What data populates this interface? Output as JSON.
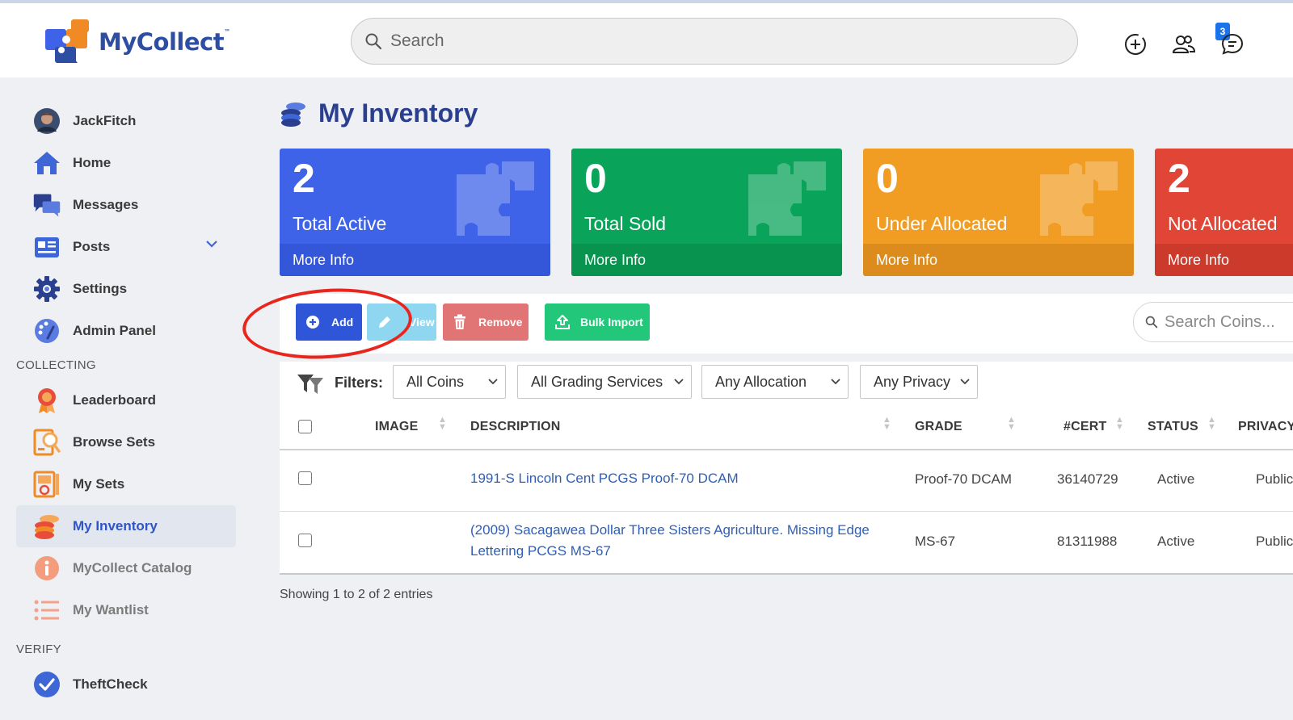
{
  "app": {
    "name": "MyCollect",
    "trademark": "™"
  },
  "header": {
    "search_placeholder": "Search",
    "notifications_badge": "3",
    "icons": [
      "add-circle-icon",
      "users-icon",
      "chat-icon"
    ]
  },
  "sidebar": {
    "user": "JackFitch",
    "items": [
      {
        "label": "Home",
        "icon": "home-icon"
      },
      {
        "label": "Messages",
        "icon": "messages-icon"
      },
      {
        "label": "Posts",
        "icon": "posts-icon"
      },
      {
        "label": "Settings",
        "icon": "gear-icon"
      },
      {
        "label": "Admin Panel",
        "icon": "palette-icon"
      }
    ],
    "collecting_header": "COLLECTING",
    "collecting": [
      {
        "label": "Leaderboard",
        "icon": "medal-icon"
      },
      {
        "label": "Browse Sets",
        "icon": "browse-sets-icon"
      },
      {
        "label": "My Sets",
        "icon": "my-sets-icon"
      },
      {
        "label": "My Inventory",
        "icon": "coins-stack-icon",
        "active": true
      },
      {
        "label": "MyCollect Catalog",
        "icon": "info-icon"
      },
      {
        "label": "My Wantlist",
        "icon": "list-icon"
      }
    ],
    "verify_header": "VERIFY",
    "verify": [
      {
        "label": "TheftCheck",
        "icon": "check-badge-icon"
      }
    ]
  },
  "page": {
    "title": "My Inventory"
  },
  "cards": [
    {
      "value": "2",
      "label": "Total Active",
      "more": "More Info",
      "color": "#3f63e8"
    },
    {
      "value": "0",
      "label": "Total Sold",
      "more": "More Info",
      "color": "#0aa35a"
    },
    {
      "value": "0",
      "label": "Under Allocated",
      "more": "More Info",
      "color": "#f19d24"
    },
    {
      "value": "2",
      "label": "Not Allocated",
      "more": "More Info",
      "color": "#e14536"
    }
  ],
  "toolbar": {
    "add": "Add",
    "view": "View",
    "remove": "Remove",
    "bulk_import": "Bulk Import",
    "search_placeholder": "Search Coins..."
  },
  "filters": {
    "label": "Filters:",
    "coins": "All Coins",
    "grading": "All Grading Services",
    "allocation": "Any Allocation",
    "privacy": "Any Privacy"
  },
  "table": {
    "columns": [
      "IMAGE",
      "DESCRIPTION",
      "GRADE",
      "#CERT",
      "STATUS",
      "PRIVACY"
    ],
    "rows": [
      {
        "description": "1991-S Lincoln Cent PCGS Proof-70 DCAM",
        "grade": "Proof-70 DCAM",
        "cert": "36140729",
        "status": "Active",
        "privacy": "Public"
      },
      {
        "description_line1": "(2009) Sacagawea Dollar Three Sisters Agriculture. Missing Edge",
        "description_line2": "Lettering PCGS MS-67",
        "grade": "MS-67",
        "cert": "81311988",
        "status": "Active",
        "privacy": "Public"
      }
    ],
    "footer": "Showing 1 to 2 of 2 entries"
  }
}
